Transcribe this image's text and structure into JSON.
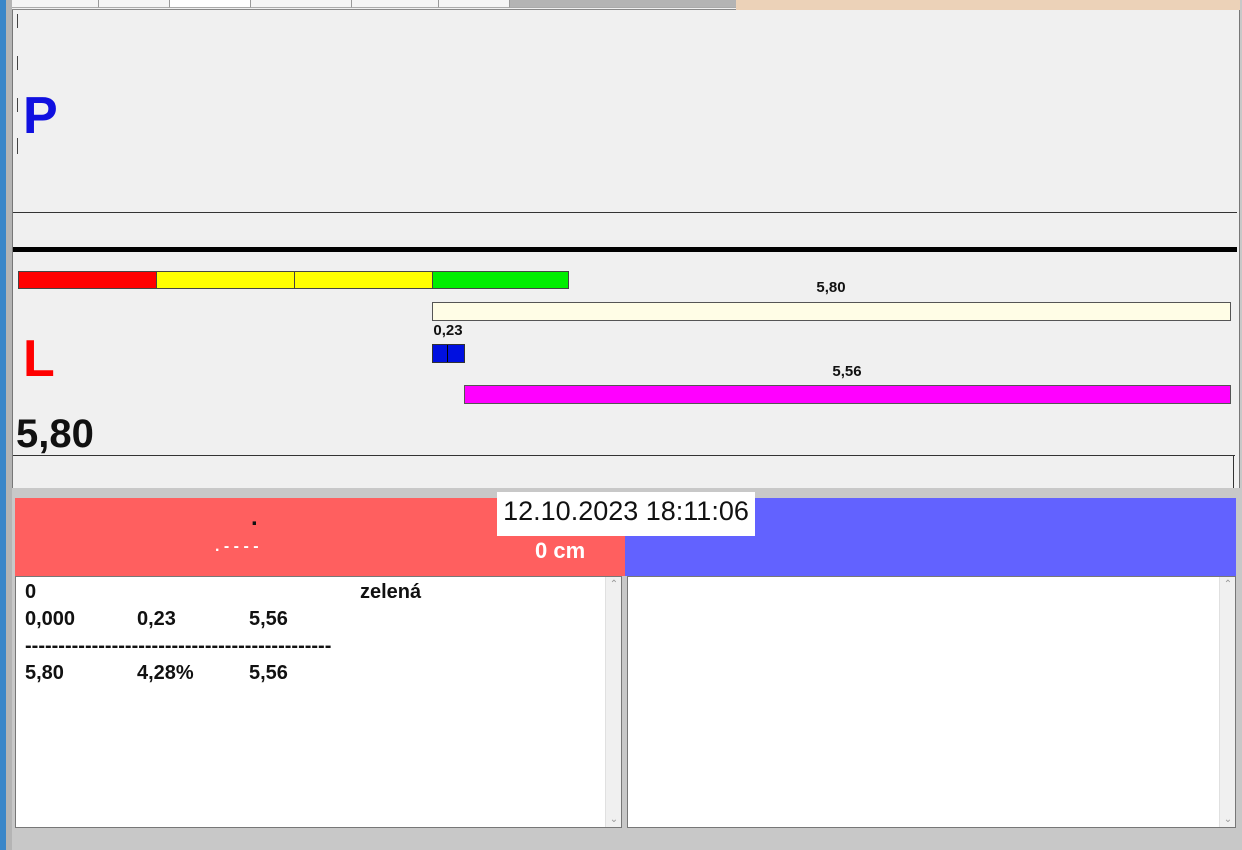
{
  "left_panel": {
    "label": "P"
  },
  "right_panel": {
    "label": "L",
    "value": "5,80"
  },
  "bars": {
    "total_label": "5,80",
    "small_label": "0,23",
    "main_label": "5,56"
  },
  "colors": {
    "segment_red": "#ff0000",
    "segment_yellow": "#ffff00",
    "segment_green": "#00ee00",
    "bar_total": "#fffde6",
    "bar_small": "#0010e0",
    "bar_main": "#ff00ff",
    "header_red": "#ff5f5f",
    "header_blue": "#6262ff"
  },
  "status": {
    "datetime": "12.10.2023 18:11:06",
    "dot": ".",
    "dash_pattern": ". - - - -",
    "depth": "0 cm"
  },
  "results": {
    "row1": {
      "c1": "0",
      "c2": "zelená"
    },
    "row2": {
      "c1": "0,000",
      "c2": "0,23",
      "c3": "5,56"
    },
    "separator": "----------------------------------------------",
    "row3": {
      "c1": "5,80",
      "c2": "4,28%",
      "c3": "5,56"
    }
  }
}
